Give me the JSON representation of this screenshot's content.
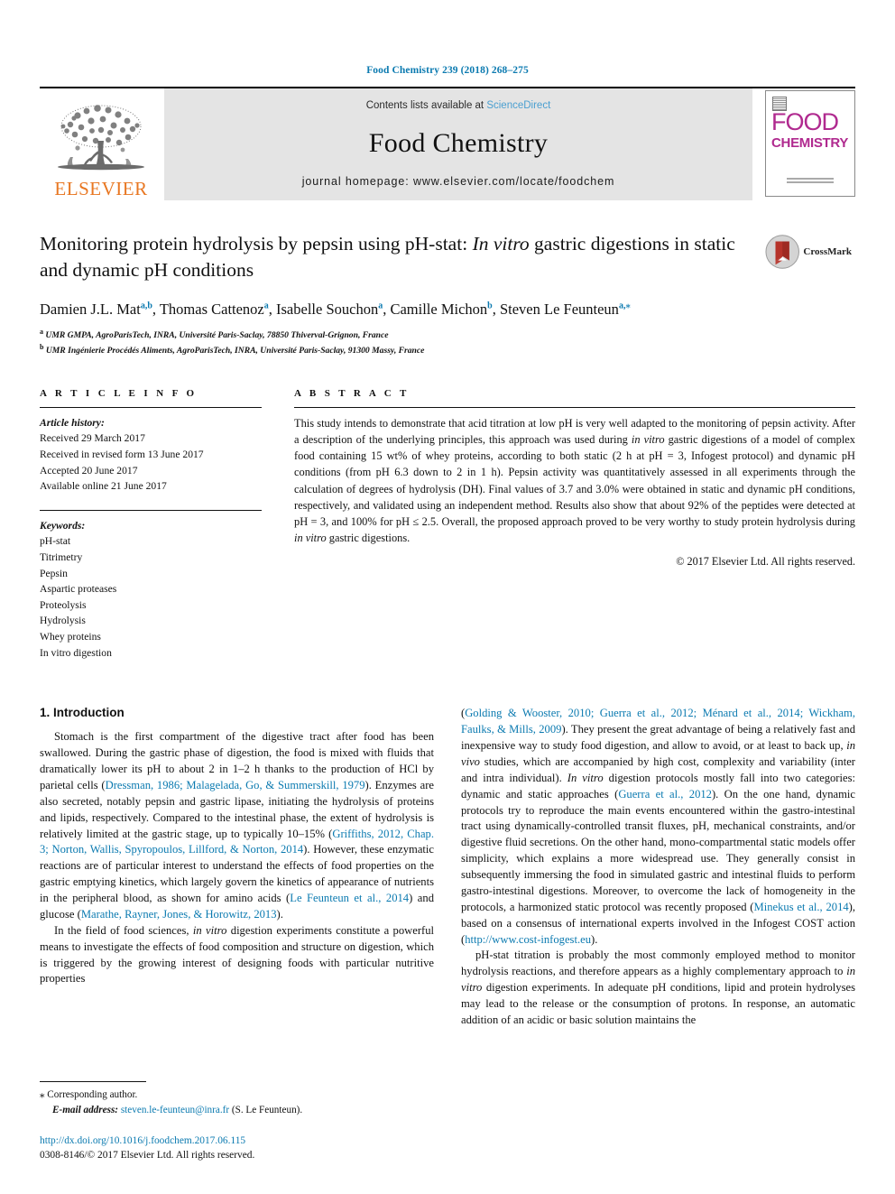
{
  "running_head": "Food Chemistry 239 (2018) 268–275",
  "masthead": {
    "publisher_name": "ELSEVIER",
    "contents_prefix": "Contents lists available at ",
    "sciencedirect": "ScienceDirect",
    "journal_name": "Food Chemistry",
    "homepage": "journal homepage: www.elsevier.com/locate/foodchem",
    "cover": {
      "line1": "FOOD",
      "line2": "CHEMISTRY"
    }
  },
  "article": {
    "title_part1": "Monitoring protein hydrolysis by pepsin using pH-stat: ",
    "title_italic": "In vitro",
    "title_part2": " gastric digestions in static and dynamic pH conditions",
    "crossmark_label": "CrossMark",
    "authors": "Damien J.L. Mat a,b, Thomas Cattenoz a, Isabelle Souchon a, Camille Michon b, Steven Le Feunteun a,*",
    "affiliations": [
      "a UMR GMPA, AgroParisTech, INRA, Université Paris-Saclay, 78850 Thiverval-Grignon, France",
      "b UMR Ingénierie Procédés Aliments, AgroParisTech, INRA, Université Paris-Saclay, 91300 Massy, France"
    ]
  },
  "info": {
    "heading": "A R T I C L E   I N F O",
    "history_label": "Article history:",
    "history": [
      "Received 29 March 2017",
      "Received in revised form 13 June 2017",
      "Accepted 20 June 2017",
      "Available online 21 June 2017"
    ],
    "keywords_label": "Keywords:",
    "keywords": [
      "pH-stat",
      "Titrimetry",
      "Pepsin",
      "Aspartic proteases",
      "Proteolysis",
      "Hydrolysis",
      "Whey proteins",
      "In vitro digestion"
    ]
  },
  "abstract": {
    "heading": "A B S T R A C T",
    "text_1": "This study intends to demonstrate that acid titration at low pH is very well adapted to the monitoring of pepsin activity. After a description of the underlying principles, this approach was used during ",
    "italic_1": "in vitro",
    "text_2": " gastric digestions of a model of complex food containing 15 wt% of whey proteins, according to both static (2 h at pH = 3, Infogest protocol) and dynamic pH conditions (from pH 6.3 down to 2 in 1 h). Pepsin activity was quantitatively assessed in all experiments through the calculation of degrees of hydrolysis (DH). Final values of 3.7 and 3.0% were obtained in static and dynamic pH conditions, respectively, and validated using an independent method. Results also show that about 92% of the peptides were detected at pH = 3, and 100% for pH ≤ 2.5. Overall, the proposed approach proved to be very worthy to study protein hydrolysis during ",
    "italic_2": "in vitro",
    "text_3": " gastric digestions.",
    "copyright": "© 2017 Elsevier Ltd. All rights reserved."
  },
  "introduction": {
    "section_title": "1. Introduction",
    "left": {
      "p1_a": "Stomach is the first compartment of the digestive tract after food has been swallowed. During the gastric phase of digestion, the food is mixed with fluids that dramatically lower its pH to about 2 in 1–2 h thanks to the production of HCl by parietal cells (",
      "p1_cit1": "Dressman, 1986; Malagelada, Go, & Summerskill, 1979",
      "p1_b": "). Enzymes are also secreted, notably pepsin and gastric lipase, initiating the hydrolysis of proteins and lipids, respectively. Compared to the intestinal phase, the extent of hydrolysis is relatively limited at the gastric stage, up to typically 10–15% (",
      "p1_cit2": "Griffiths, 2012, Chap. 3; Norton, Wallis, Spyropoulos, Lillford, & Norton, 2014",
      "p1_c": "). However, these enzymatic reactions are of particular interest to understand the effects of food properties on the gastric emptying kinetics, which largely govern the kinetics of appearance of nutrients in the peripheral blood, as shown for amino acids (",
      "p1_cit3": "Le Feunteun et al., 2014",
      "p1_d": ") and glucose (",
      "p1_cit4": "Marathe, Rayner, Jones, & Horowitz, 2013",
      "p1_e": ").",
      "p2_a": "In the field of food sciences, ",
      "p2_italic": "in vitro",
      "p2_b": " digestion experiments constitute a powerful means to investigate the effects of food composition and structure on digestion, which is triggered by the growing interest of designing foods with particular nutritive properties"
    },
    "right": {
      "p2_cit1": "Golding & Wooster, 2010; Guerra et al., 2012; Ménard et al., 2014; Wickham, Faulks, & Mills, 2009",
      "p2_c": "). They present the great advantage of being a relatively fast and inexpensive way to study food digestion, and allow to avoid, or at least to back up, ",
      "p2_italic2": "in vivo",
      "p2_d": " studies, which are accompanied by high cost, complexity and variability (inter and intra individual). ",
      "p2_italic3": "In vitro",
      "p2_e": " digestion protocols mostly fall into two categories: dynamic and static approaches (",
      "p2_cit2": "Guerra et al., 2012",
      "p2_f": "). On the one hand, dynamic protocols try to reproduce the main events encountered within the gastro-intestinal tract using dynamically-controlled transit fluxes, pH, mechanical constraints, and/or digestive fluid secretions. On the other hand, mono-compartmental static models offer simplicity, which explains a more widespread use. They generally consist in subsequently immersing the food in simulated gastric and intestinal fluids to perform gastro-intestinal digestions. Moreover, to overcome the lack of homogeneity in the protocols, a harmonized static protocol was recently proposed (",
      "p2_cit3": "Minekus et al., 2014",
      "p2_g": "), based on a consensus of international experts involved in the Infogest COST action (",
      "p2_cit4": "http://www.cost-infogest.eu",
      "p2_h": ").",
      "p3_a": "pH-stat titration is probably the most commonly employed method to monitor hydrolysis reactions, and therefore appears as a highly complementary approach to ",
      "p3_italic": "in vitro",
      "p3_b": " digestion experiments. In adequate pH conditions, lipid and protein hydrolyses may lead to the release or the consumption of protons. In response, an automatic addition of an acidic or basic solution maintains the"
    }
  },
  "footer": {
    "corresponding_star": "⁎",
    "corresponding_label": " Corresponding author.",
    "email_label": "E-mail address:",
    "email": "steven.le-feunteun@inra.fr",
    "email_suffix": " (S. Le Feunteun).",
    "doi": "http://dx.doi.org/10.1016/j.foodchem.2017.06.115",
    "issn": "0308-8146/© 2017 Elsevier Ltd. All rights reserved."
  },
  "colors": {
    "link_blue": "#0b7ab0",
    "sciencedirect_blue": "#4a9fd0",
    "elsevier_orange": "#e87722",
    "cover_magenta": "#b02a8f",
    "crossmark_red": "#9e2a22"
  }
}
